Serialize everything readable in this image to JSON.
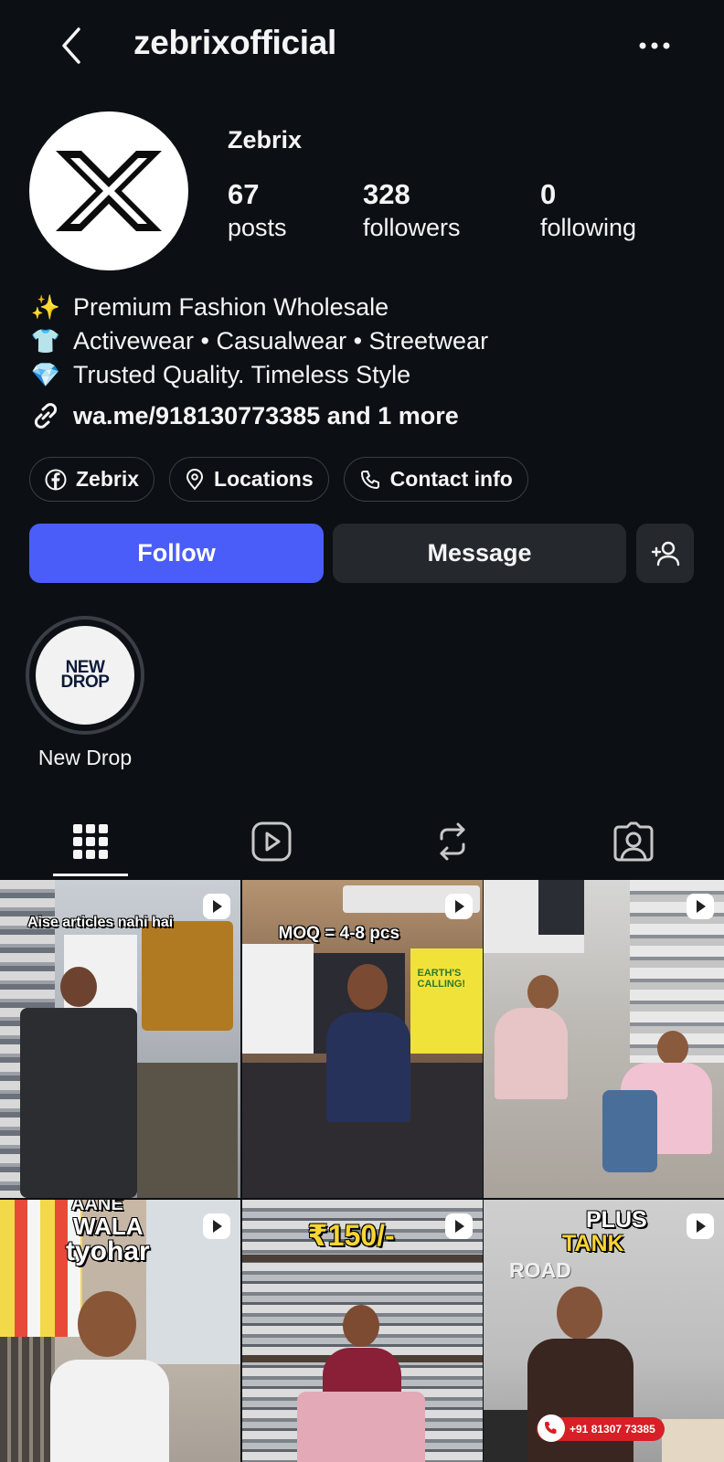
{
  "header": {
    "username": "zebrixofficial"
  },
  "profile": {
    "display_name": "Zebrix",
    "stats": [
      {
        "value": "67",
        "label": "posts"
      },
      {
        "value": "328",
        "label": "followers"
      },
      {
        "value": "0",
        "label": "following"
      }
    ],
    "bio": [
      {
        "icon": "sparkles-icon",
        "emoji": "✨",
        "text": "Premium Fashion Wholesale"
      },
      {
        "icon": "tshirt-icon",
        "emoji": "👕",
        "text": "Activewear • Casualwear • Streetwear"
      },
      {
        "icon": "gem-icon",
        "emoji": "💎",
        "text": "Trusted Quality. Timeless Style"
      }
    ],
    "link": "wa.me/918130773385 and 1 more"
  },
  "chips": {
    "facebook": "Zebrix",
    "locations": "Locations",
    "contact": "Contact info"
  },
  "actions": {
    "follow": "Follow",
    "message": "Message"
  },
  "highlights": [
    {
      "cover_line1": "NEW",
      "cover_line2": "DROP",
      "label": "New Drop"
    }
  ],
  "posts": [
    {
      "overlay": "Aise articles nahi hai"
    },
    {
      "overlay": "MOQ = 4-8 pcs",
      "shirt_text": "EARTH'S CALLING!"
    },
    {
      "overlay": ""
    },
    {
      "overlay_line1": "AANE",
      "overlay_line2": "WALA",
      "overlay_line3": "tyohar"
    },
    {
      "overlay": "₹150/-"
    },
    {
      "overlay_line1": "PLUS",
      "overlay_line2": "TANK",
      "overlay_line3": "ROAD",
      "phone": "+91 81307 73385"
    }
  ],
  "colors": {
    "background": "#0c1014",
    "follow_button": "#4a5df9",
    "secondary_button": "#25292e"
  }
}
